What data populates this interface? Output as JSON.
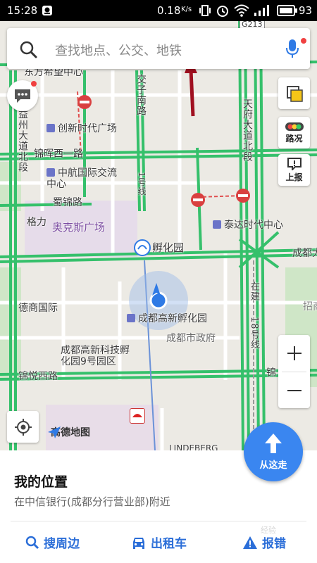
{
  "status_bar": {
    "time": "15:28",
    "net_speed": "0.18",
    "net_unit": "K/s",
    "battery": "93"
  },
  "search": {
    "placeholder": "查找地点、公交、地铁"
  },
  "map": {
    "road_tag": "G213",
    "labels": {
      "dongfang": "东方希望中心",
      "jiaozi": "交子南路",
      "tianfu": "天府大道北段",
      "yizhou": "益州大道北段",
      "jinhui": "锦晖西一路",
      "chuangxin": "创新时代广场",
      "zhonghang": "中航国际交流中心",
      "shuxiu": "蜀锦路",
      "gele": "格力",
      "aokesi": "奥克斯广场",
      "yihao": "1号线",
      "fuhuayuan": "孵化园",
      "taida": "泰达时代中心",
      "chengdu_da": "成都大",
      "zhaoshang": "招商",
      "deshang": "德商国际",
      "gaoxin_fuhua": "成都高新孵化园",
      "zhengfu": "成都市政府",
      "gaoxin_keji": "成都高新科技孵化园9号园区",
      "zaijian": "在建",
      "line18": "18号线",
      "jinyue": "锦悦西路",
      "jin": "锦",
      "lindeberg": "LINDEBERG",
      "logo": "高德地图"
    }
  },
  "side_buttons": {
    "traffic_label": "路况",
    "report_label": "上报"
  },
  "panel": {
    "title": "我的位置",
    "subtitle": "在中信银行(成都分行营业部)附近",
    "go_label": "从这走",
    "actions": {
      "nearby": "搜周边",
      "taxi": "出租车",
      "error": "报错"
    }
  },
  "watermark": "经验"
}
